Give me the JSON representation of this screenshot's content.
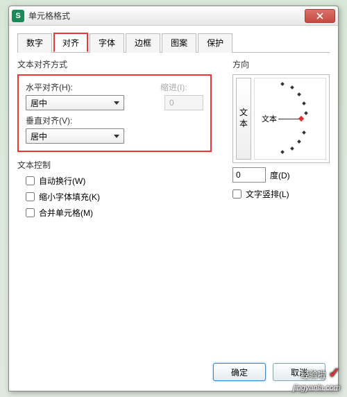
{
  "title": "单元格格式",
  "tabs": [
    {
      "label": "数字"
    },
    {
      "label": "对齐",
      "active": true
    },
    {
      "label": "字体"
    },
    {
      "label": "边框"
    },
    {
      "label": "图案"
    },
    {
      "label": "保护"
    }
  ],
  "align_section": {
    "heading": "文本对齐方式",
    "h_label": "水平对齐(H):",
    "h_value": "居中",
    "indent_label": "缩进(I):",
    "indent_value": "0",
    "v_label": "垂直对齐(V):",
    "v_value": "居中"
  },
  "text_control": {
    "heading": "文本控制",
    "wrap": "自动换行(W)",
    "shrink": "缩小字体填充(K)",
    "merge": "合并单元格(M)"
  },
  "orientation": {
    "heading": "方向",
    "vert_char1": "文",
    "vert_char2": "本",
    "center_label": "文本",
    "degree_value": "0",
    "degree_label": "度(D)",
    "vertical_check": "文字竖排(L)"
  },
  "buttons": {
    "ok": "确定",
    "cancel": "取消"
  },
  "watermark": {
    "main": "经验啦",
    "sub": "jingyanla.com"
  }
}
